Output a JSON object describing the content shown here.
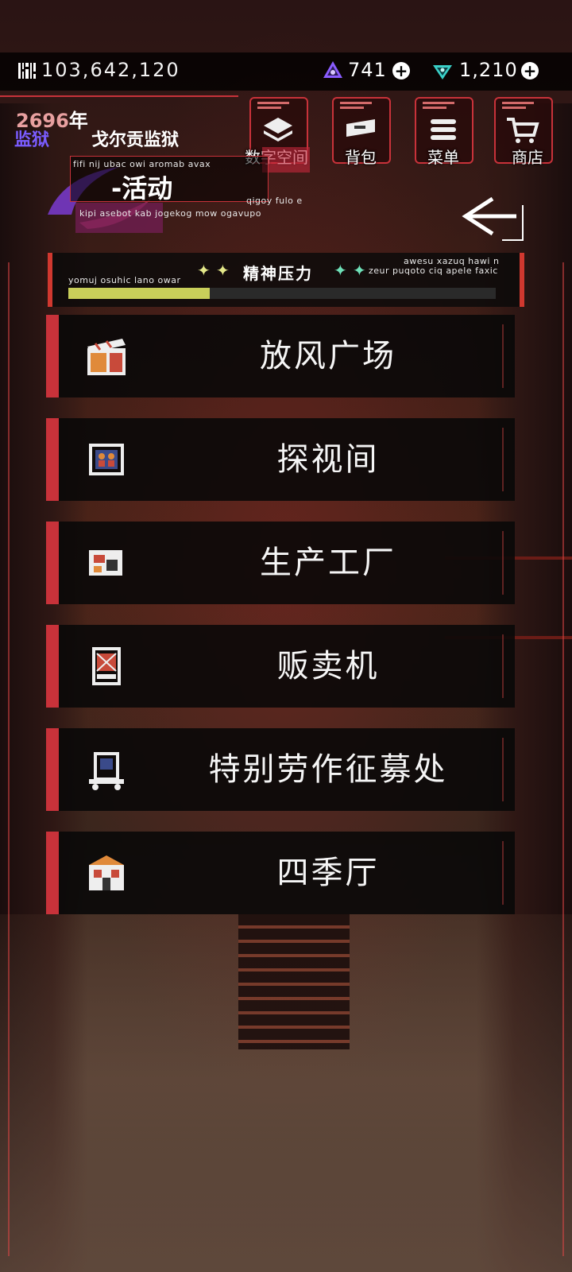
{
  "currency": {
    "coins": "103,642,120",
    "gem_purple": "741",
    "gem_teal": "1,210",
    "coin_icon": "barcode-coin-icon",
    "gem_purple_icon": "purple-crystal-icon",
    "gem_teal_icon": "teal-crystal-icon",
    "plus_glyph": "+"
  },
  "header": {
    "year_number": "2696",
    "year_unit": "年",
    "prison_tag": "监狱",
    "prison_name": "戈尔贡监狱"
  },
  "nav": [
    {
      "label": "数字空间",
      "icon": "layers-icon"
    },
    {
      "label": "背包",
      "icon": "bag-icon"
    },
    {
      "label": "菜单",
      "icon": "menu-list-icon"
    },
    {
      "label": "商店",
      "icon": "cart-icon"
    }
  ],
  "activity": {
    "title": "-活动",
    "caption_top": "fifi nij ubac owi aromab avax",
    "caption_bottom": "kipi asebot kab jogekog mow ogavupo",
    "caption_right": "qigoy fulo e"
  },
  "stress": {
    "title": "精神压力",
    "caption_left": "yomuj osuhic lano owar",
    "caption_right_1": "awesu xazuq hawi n",
    "caption_right_2": "zeur puqoto ciq apele faxic",
    "level_fraction": 0.33,
    "fill_color": "#c9cf5a"
  },
  "menu": [
    {
      "label": "放风广场",
      "icon": "clapper-board-icon"
    },
    {
      "label": "探视间",
      "icon": "visiting-frame-icon"
    },
    {
      "label": "生产工厂",
      "icon": "factory-machine-icon"
    },
    {
      "label": "贩卖机",
      "icon": "vending-machine-icon"
    },
    {
      "label": "特别劳作征募处",
      "icon": "recruit-cart-icon"
    },
    {
      "label": "四季厅",
      "icon": "building-icon"
    }
  ],
  "colors": {
    "accent_red": "#c8323a",
    "panel": "#080808"
  }
}
